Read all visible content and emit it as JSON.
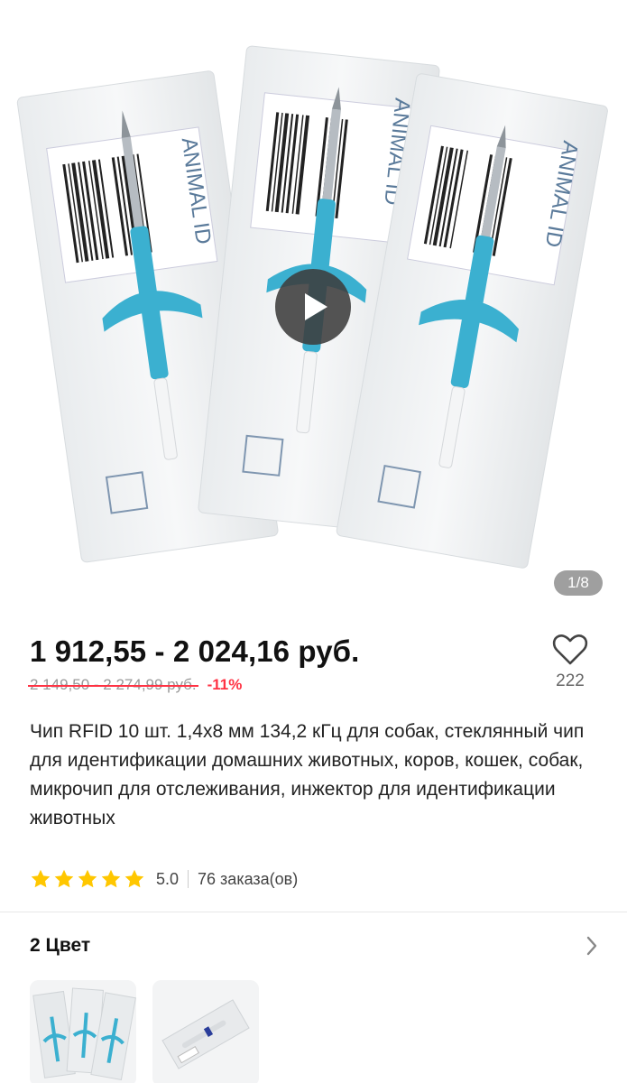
{
  "gallery": {
    "page_indicator": "1/8",
    "play_icon": "play-icon"
  },
  "price": {
    "current": "1 912,55 - 2 024,16 руб.",
    "old": "2 149,50 - 2 274,99 руб.",
    "discount": "-11%"
  },
  "wishlist": {
    "icon": "heart-icon",
    "count": "222"
  },
  "product": {
    "title": "Чип RFID 10 шт. 1,4x8 мм 134,2 кГц для собак, стеклянный чип для идентификации домашних животных, коров, кошек, собак, микрочип для отслеживания, инжектор для идентификации животных"
  },
  "rating": {
    "stars": 5,
    "value": "5.0",
    "orders": "76 заказа(ов)",
    "star_color": "#ffc700"
  },
  "colors": {
    "heading": "2 Цвет",
    "chevron_icon": "chevron-right-icon",
    "options": [
      {
        "name": "color-option-1",
        "description": "three-syringes"
      },
      {
        "name": "color-option-2",
        "description": "single-syringe"
      }
    ]
  },
  "theme": {
    "accent": "#ff3344",
    "syringe": "#3bb0d0"
  }
}
